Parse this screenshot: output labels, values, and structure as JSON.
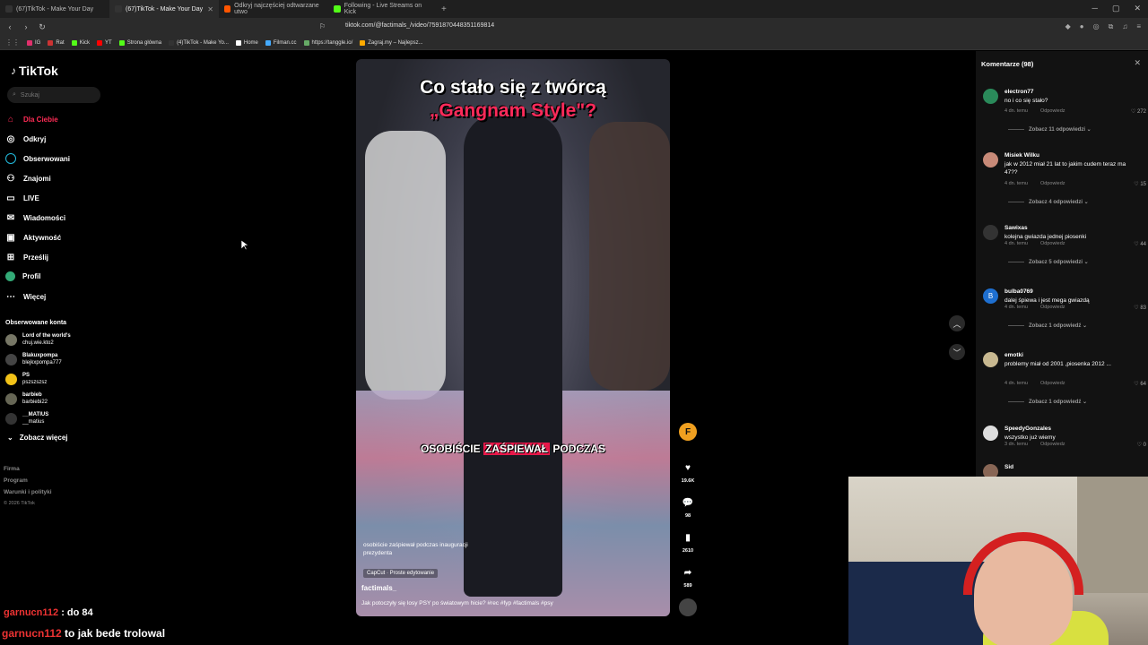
{
  "browser": {
    "tabs": [
      {
        "label": "(67)TikTok - Make Your Day",
        "color": "#222222"
      },
      {
        "label": "(67)TikTok - Make Your Day",
        "color": "#222222"
      },
      {
        "label": "Odkryj najczęściej odtwarzane utwo",
        "color": "#ff5500"
      },
      {
        "label": "Following - Live Streams on Kick",
        "color": "#53fc18"
      }
    ],
    "url": "tiktok.com/@factimals_/video/7591870448351169814",
    "bookmarks": [
      "IG",
      "Rat",
      "Kick",
      "YT",
      "Strona główna",
      "(4)TikTok - Make Yo...",
      "Home",
      "Filman.cc",
      "https://tanggle.io/",
      "Zagraj.my – Najlepsz..."
    ]
  },
  "sidebar": {
    "logo": "TikTok",
    "search_placeholder": "Szukaj",
    "nav": [
      {
        "label": "Dla Ciebie",
        "icon": "home-icon"
      },
      {
        "label": "Odkryj",
        "icon": "compass-icon"
      },
      {
        "label": "Obserwowani",
        "icon": "following-icon"
      },
      {
        "label": "Znajomi",
        "icon": "friends-icon"
      },
      {
        "label": "LIVE",
        "icon": "live-icon"
      },
      {
        "label": "Wiadomości",
        "icon": "messages-icon"
      },
      {
        "label": "Aktywność",
        "icon": "activity-icon"
      },
      {
        "label": "Prześlij",
        "icon": "upload-icon"
      },
      {
        "label": "Profil",
        "icon": "profile-icon"
      },
      {
        "label": "Więcej",
        "icon": "more-icon"
      }
    ],
    "followed_title": "Obserwowane konta",
    "followed": [
      {
        "name": "Lord of the world's",
        "handle": "chuj.wie.kto2"
      },
      {
        "name": "Blakuxpompa",
        "handle": "blejkxpompa777"
      },
      {
        "name": "PS",
        "handle": "pszszszsz"
      },
      {
        "name": "barbieb",
        "handle": "barbiebi22"
      },
      {
        "name": "__MATIUS",
        "handle": "__matius"
      }
    ],
    "see_more": "Zobacz więcej",
    "footer": [
      "Firma",
      "Program",
      "Warunki i polityki",
      "© 2026 TikTok"
    ]
  },
  "video": {
    "title_line1": "Co stało się z twórcą",
    "title_line2": "„Gangnam Style\"?",
    "subtitle_pre": "OSOBIŚCIE",
    "subtitle_hl": "ZAŚPIEWAŁ",
    "subtitle_post": "PODCZAS",
    "desc": "osobiście zaśpiewał podczas inauguracji prezydenta",
    "capcut": "CapCut · Proste edytowanie",
    "author": "factimals_",
    "caption": "Jak potoczyły się losy PSY po światowym hicie? #rec #fyp #factimals #psy",
    "likes": "19.6K",
    "comments": "98",
    "saves": "2610",
    "shares": "589"
  },
  "comments": {
    "header": "Komentarze (98)",
    "items": [
      {
        "user": "electron77",
        "text": "no i co się stało?",
        "time": "4 dn. temu",
        "reply": "Odpowiedz",
        "likes": "272",
        "more": "Zobacz 11 odpowiedzi",
        "color": "#2a8a5a"
      },
      {
        "user": "Misiek Wilku",
        "text": "jak w 2012 miał 21 lat to jakim cudem teraz ma 47??",
        "time": "4 dn. temu",
        "reply": "Odpowiedz",
        "likes": "15",
        "more": "Zobacz 4 odpowiedzi",
        "color": "#c88a78"
      },
      {
        "user": "Sawixas",
        "text": "kolejna gwiazda jednej piosenki",
        "time": "4 dn. temu",
        "reply": "Odpowiedz",
        "likes": "44",
        "more": "Zobacz 5 odpowiedzi",
        "color": "#333333"
      },
      {
        "user": "bulba0769",
        "text": "dalej śpiewa i jest mega gwiazdą",
        "time": "4 dn. temu",
        "reply": "Odpowiedz",
        "likes": "83",
        "more": "Zobacz 1 odpowiedź",
        "color": "#1e6fd0"
      },
      {
        "user": "emotki",
        "text": "problemy miał od 2001 ,piosenka 2012 ...",
        "time": "4 dn. temu",
        "reply": "Odpowiedz",
        "likes": "64",
        "more": "Zobacz 1 odpowiedź",
        "color": "#c8b890"
      },
      {
        "user": "SpeedyGonzales",
        "text": "wszystko już wiemy",
        "time": "3 dn. temu",
        "reply": "Odpowiedz",
        "likes": "0",
        "more": "",
        "color": "#dddddd"
      },
      {
        "user": "Sid",
        "text": "",
        "time": "",
        "reply": "",
        "likes": "",
        "more": "",
        "color": "#886655"
      }
    ]
  },
  "chat": {
    "line1_nick": "garnucn112",
    "line1_text": ": do 84",
    "line2_nick": "garnucn112",
    "line2_text": "to jak bede trolowal"
  },
  "colors": {
    "accent": "#fe2c55",
    "bg": "#000000",
    "panel": "#121212"
  }
}
